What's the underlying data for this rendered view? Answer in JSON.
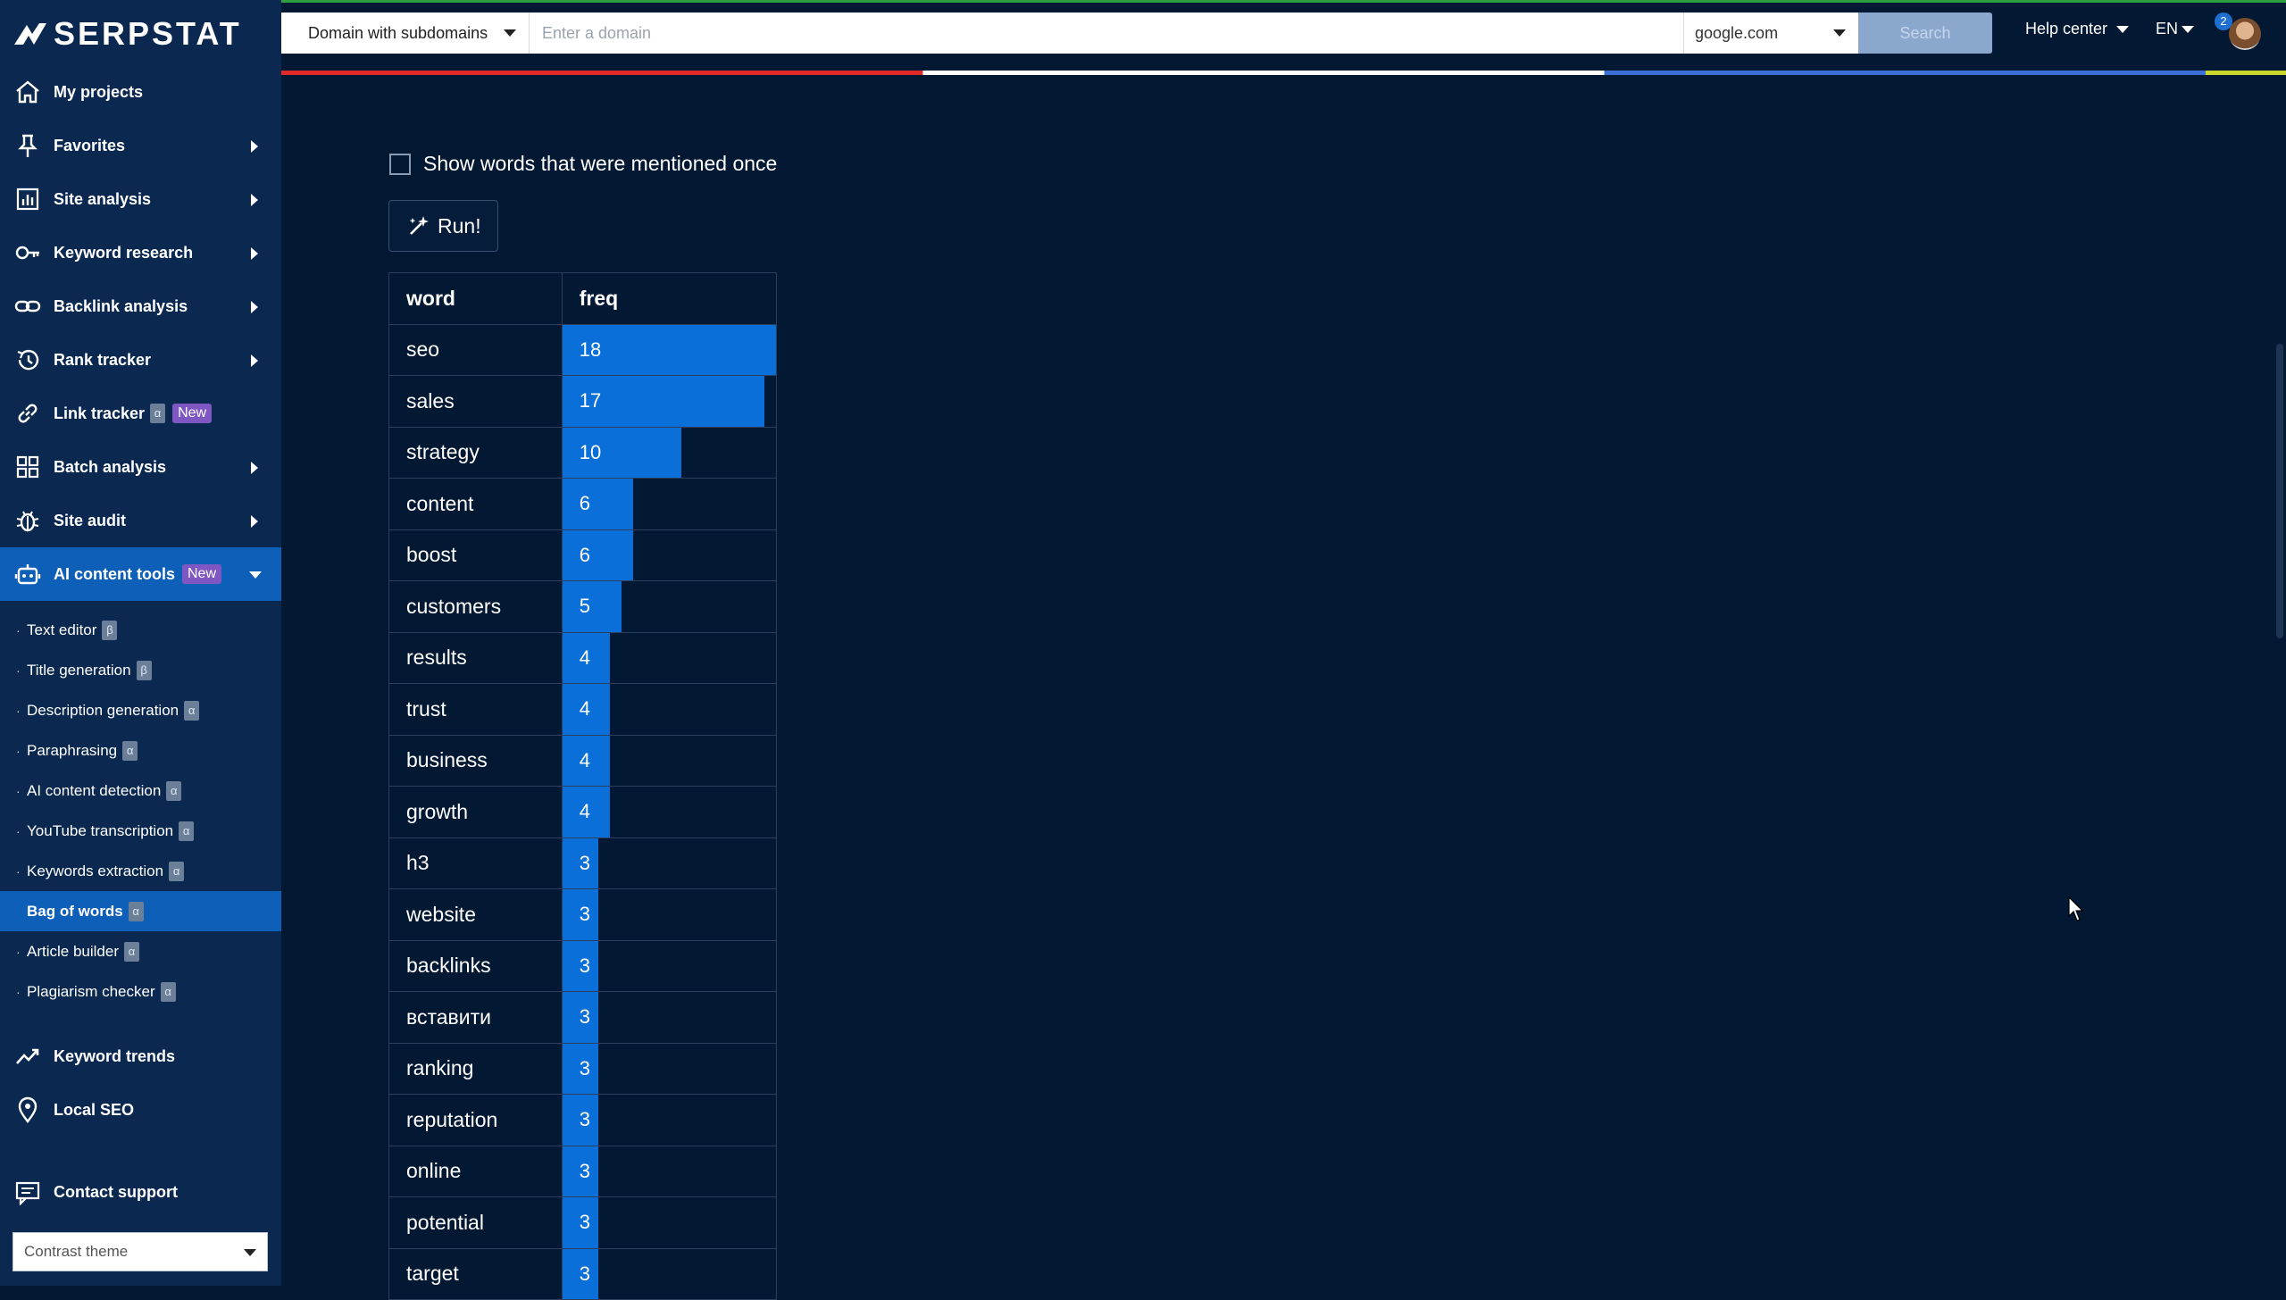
{
  "brand": {
    "name": "SERPSTAT"
  },
  "sidebar": {
    "items": [
      {
        "label": "My projects",
        "icon": "home-icon",
        "arrow": false
      },
      {
        "label": "Favorites",
        "icon": "pin-icon",
        "arrow": true
      },
      {
        "label": "Site analysis",
        "icon": "chart-icon",
        "arrow": true
      },
      {
        "label": "Keyword research",
        "icon": "key-icon",
        "arrow": true
      },
      {
        "label": "Backlink analysis",
        "icon": "link-icon",
        "arrow": true
      },
      {
        "label": "Rank tracker",
        "icon": "history-icon",
        "arrow": true
      },
      {
        "label": "Link tracker",
        "icon": "chain-icon",
        "arrow": false,
        "badge_greek": "α",
        "badge_new": "New"
      },
      {
        "label": "Batch analysis",
        "icon": "grid-icon",
        "arrow": true
      },
      {
        "label": "Site audit",
        "icon": "bug-icon",
        "arrow": true
      },
      {
        "label": "AI content tools",
        "icon": "robot-icon",
        "arrow": true,
        "badge_new": "New",
        "active": true
      }
    ],
    "subitems": [
      {
        "label": "Text editor",
        "tag": "β"
      },
      {
        "label": "Title generation",
        "tag": "β"
      },
      {
        "label": "Description generation",
        "tag": "α"
      },
      {
        "label": "Paraphrasing",
        "tag": "α"
      },
      {
        "label": "AI content detection",
        "tag": "α"
      },
      {
        "label": "YouTube transcription",
        "tag": "α"
      },
      {
        "label": "Keywords extraction",
        "tag": "α"
      },
      {
        "label": "Bag of words",
        "tag": "α",
        "active": true
      },
      {
        "label": "Article builder",
        "tag": "α"
      },
      {
        "label": "Plagiarism checker",
        "tag": "α"
      }
    ],
    "bottom_items": [
      {
        "label": "Keyword trends",
        "icon": "trend-icon"
      },
      {
        "label": "Local SEO",
        "icon": "location-icon"
      }
    ],
    "support_label": "Contact support",
    "theme_label": "Contrast theme"
  },
  "topbar": {
    "scope_label": "Domain with subdomains",
    "domain_placeholder": "Enter a domain",
    "database_label": "google.com",
    "search_label": "Search",
    "help_label": "Help center",
    "lang_label": "EN",
    "notification_count": "2"
  },
  "content": {
    "once_label": "Show words that were mentioned once",
    "run_label": "Run!",
    "table": {
      "columns": [
        "word",
        "freq"
      ],
      "rows": [
        {
          "word": "seo",
          "freq": 18
        },
        {
          "word": "sales",
          "freq": 17
        },
        {
          "word": "strategy",
          "freq": 10
        },
        {
          "word": "content",
          "freq": 6
        },
        {
          "word": "boost",
          "freq": 6
        },
        {
          "word": "customers",
          "freq": 5
        },
        {
          "word": "results",
          "freq": 4
        },
        {
          "word": "trust",
          "freq": 4
        },
        {
          "word": "business",
          "freq": 4
        },
        {
          "word": "growth",
          "freq": 4
        },
        {
          "word": "h3",
          "freq": 3
        },
        {
          "word": "website",
          "freq": 3
        },
        {
          "word": "backlinks",
          "freq": 3
        },
        {
          "word": "вставити",
          "freq": 3
        },
        {
          "word": "ranking",
          "freq": 3
        },
        {
          "word": "reputation",
          "freq": 3
        },
        {
          "word": "online",
          "freq": 3
        },
        {
          "word": "potential",
          "freq": 3
        },
        {
          "word": "target",
          "freq": 3
        }
      ]
    }
  },
  "colors": {
    "background": "#031833",
    "sidebar": "#0b2850",
    "accent": "#0b6fd9",
    "badge_new": "#7e57c2"
  }
}
